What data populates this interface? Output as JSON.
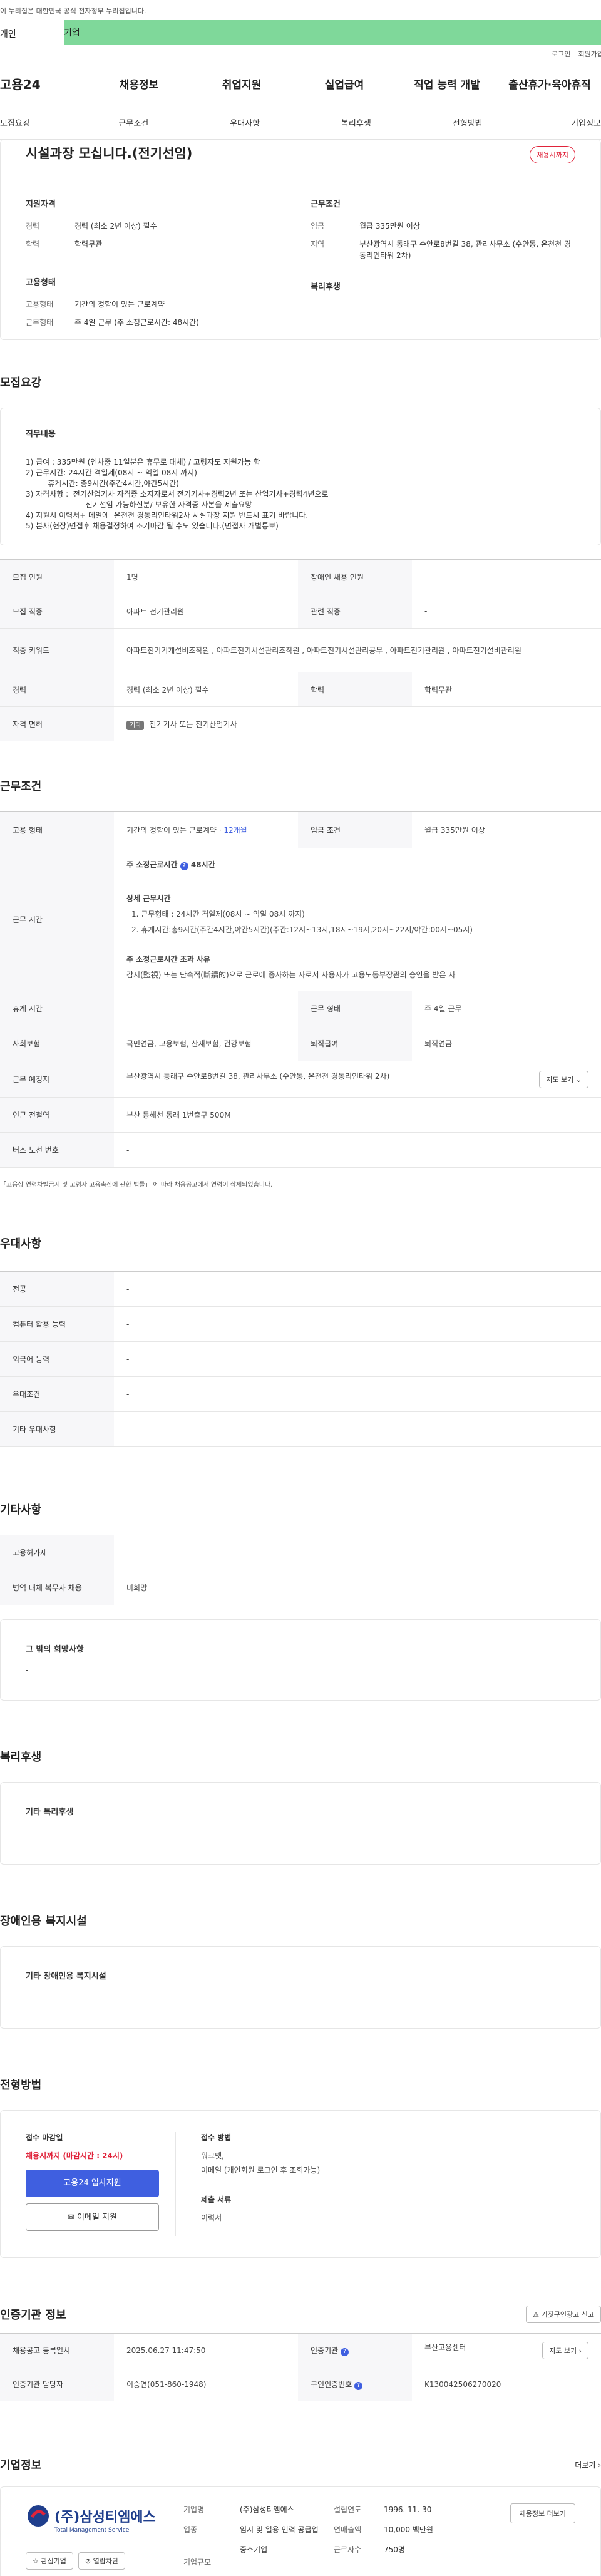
{
  "gov_banner": "이 누리집은 대한민국 공식 전자정부 누리집입니다.",
  "top_tabs": {
    "first": "개인",
    "second": "기업"
  },
  "util": {
    "login": "로그인",
    "join": "회원가입"
  },
  "gnb": {
    "logo": "고용24",
    "menus": [
      "채용정보",
      "취업지원",
      "실업급여",
      "직업 능력 개발",
      "출산휴가·육아휴직"
    ]
  },
  "anchor_tabs": [
    "모집요강",
    "근무조건",
    "우대사항",
    "복리후생",
    "전형방법",
    "기업정보"
  ],
  "summary": {
    "title": "시설과장 모십니다.(전기선임)",
    "badge": "채용시까지",
    "qual_title": "지원자격",
    "career_k": "경력",
    "career_v": "경력 (최소 2년 이상) 필수",
    "edu_k": "학력",
    "edu_v": "학력무관",
    "cond_title": "근무조건",
    "wage_k": "임금",
    "wage_v": "월급 335만원 이상",
    "region_k": "지역",
    "region_v": "부산광역시 동래구 수안로8번길 38, 관리사무소 (수안동, 온천천 경동리인타워 2차)",
    "emp_title": "고용형태",
    "emptype_k": "고용형태",
    "emptype_v": "기간의 정함이 있는 근로계약",
    "worktype_k": "근무형태",
    "worktype_v": "주 4일 근무 (주 소정근로시간: 48시간)",
    "welfare_title": "복리후생"
  },
  "recruit": {
    "section": "모집요강",
    "duty_title": "직무내용",
    "duty_lines": [
      "1) 급여 : 335만원 (연차중 11일분은 휴무로 대체) / 고령자도 지원가능 함",
      "2) 근무시간: 24시간 격일제(08시 ~ 익일 08시 까지)",
      "   휴게시간: 총9시간(주간4시간,야간5시간)",
      "3) 자격사항 :  전기산업기사 자격증 소지자로서 전기기사+경력2년 또는 산업기사+경력4년으로",
      "   전기선임 가능하신분/ 보유한 자격증 사본을 제출요망",
      "4) 지원시 이력서+ 메일에  온천천 경동리인타워2차 시설과장 지원 반드시 표기 바랍니다.",
      "5) 본사(현장)면접후 채용결정하여 조기마감 될 수도 있습니다.(면접자 개별통보)"
    ],
    "rows": {
      "headcount_k": "모집 인원",
      "headcount_v": "1명",
      "disabled_k": "장애인 채용 인원",
      "disabled_v": "-",
      "job_k": "모집 직종",
      "job_v": "아파트 전기관리원",
      "related_k": "관련 직종",
      "related_v": "-",
      "kw_k": "직종 키워드",
      "kw_v": "아파트전기기계설비조작원 , 아파트전기시설관리조작원 , 아파트전기시설관리공무 , 아파트전기관리원 , 아파트전기설비관리원",
      "career_k": "경력",
      "career_v": "경력 (최소 2년 이상) 필수",
      "edu_k": "학력",
      "edu_v": "학력무관",
      "license_k": "자격 면허",
      "license_tag": "기타",
      "license_v": "전기기사 또는 전기산업기사"
    }
  },
  "conditions": {
    "section": "근무조건",
    "emptype_k": "고용 형태",
    "emptype_v": "기간의 정함이 있는 근로계약 · ",
    "emptype_link": "12개월",
    "wage_k": "임금 조건",
    "wage_v": "월급 335만원 이상",
    "hours_k": "근무 시간",
    "hours_week": "주 소정근로시간",
    "hours_week_v": "48시간",
    "hours_detail_title": "상세 근무시간",
    "hours_detail": [
      "1. 근무형태 : 24시간 격일제(08시 ~ 익일 08시 까지)",
      "2. 휴게시간:총9시간(주간4시간,야간5시간)(주간:12시~13시,18시~19시,20시~22시/야간:00시~05시)"
    ],
    "over_title": "주 소정근로시간 초과 사유",
    "over_v": "감시(監視) 또는 단속적(斷續的)으로 근로에 종사하는 자로서 사용자가 고용노동부장관의 승인을 받은 자",
    "holiday_k": "휴게 시간",
    "holiday_v": "-",
    "worktype_k": "근무 형태",
    "worktype_v": "주 4일 근무",
    "insurance_k": "사회보험",
    "insurance_v": "국민연금, 고용보험, 산재보험, 건강보험",
    "retire_k": "퇴직급여",
    "retire_v": "퇴직연금",
    "place_k": "근무 예정지",
    "place_v": "부산광역시 동래구 수안로8번길 38, 관리사무소 (수안동, 온천천 경동리인타워 2차)",
    "map_btn": "지도 보기",
    "subway_k": "인근 전철역",
    "subway_v": "부산 동해선 동래 1번출구 500M",
    "bus_k": "버스 노선 번호",
    "bus_v": "-",
    "note": "「고용상 연령차별금지 및 고령자 고용촉진에 관한 법률」 에 따라 채용공고에서 연령이 삭제되었습니다."
  },
  "prefer": {
    "section": "우대사항",
    "rows": [
      [
        "전공",
        "-"
      ],
      [
        "컴퓨터 활용 능력",
        "-"
      ],
      [
        "외국어 능력",
        "-"
      ],
      [
        "우대조건",
        "-"
      ],
      [
        "기타 우대사항",
        "-"
      ]
    ]
  },
  "etc": {
    "section": "기타사항",
    "rows": [
      [
        "고용허가제",
        "-"
      ],
      [
        "병역 대체 복무자 채용",
        "비희망"
      ]
    ],
    "other_title": "그 밖의 희망사항",
    "other_v": "-"
  },
  "welfare": {
    "section": "복리후생",
    "title": "기타 복리후생",
    "v": "-"
  },
  "disabled": {
    "section": "장애인용 복지시설",
    "title": "기타 장애인용 복지시설",
    "v": "-"
  },
  "selection": {
    "section": "전형방법",
    "deadline_title": "접수 마감일",
    "deadline_v": "채용시까지 (마감시간 : 24시)",
    "apply_btn": "고용24 입사지원",
    "mail_btn": "이메일 지원",
    "method_title": "접수 방법",
    "method_v1": "워크넷,",
    "method_v2": "이메일 (개인회원 로그인 후 조회가능)",
    "docs_title": "제출 서류",
    "docs_v": "이력서"
  },
  "cert": {
    "section": "인증기관 정보",
    "report_btn": "거짓구인광고 신고",
    "reg_k": "채용공고 등록일시",
    "reg_v": "2025.06.27 11:47:50",
    "agency_k": "인증기관",
    "agency_v": "부산고용센터",
    "map_btn": "지도 보기",
    "manager_k": "인증기관 담당자",
    "manager_v": "이승연(051-860-1948)",
    "no_k": "구인인증번호",
    "no_v": "K130042506270020"
  },
  "company": {
    "section": "기업정보",
    "more": "더보기",
    "logo_name": "(주)삼성티엠에스",
    "logo_sub": "Total Management Service",
    "interest_btn": "관심기업",
    "block_btn": "열람차단",
    "name_k": "기업명",
    "name_v": "(주)삼성티엠에스",
    "industry_k": "업종",
    "industry_v": "임시 및 일용 인력 공급업",
    "size_k": "기업규모",
    "size_v": "중소기업",
    "founded_k": "설립연도",
    "founded_v": "1996. 11. 30",
    "sales_k": "연매출액",
    "sales_v": "10,000 백만원",
    "workers_k": "근로자수",
    "workers_v": "750명",
    "more_recruit_btn": "채용정보 더보기"
  },
  "colors": {
    "accent": "#3f5fe0",
    "danger": "#e0233a",
    "green": "#7fd89a"
  }
}
